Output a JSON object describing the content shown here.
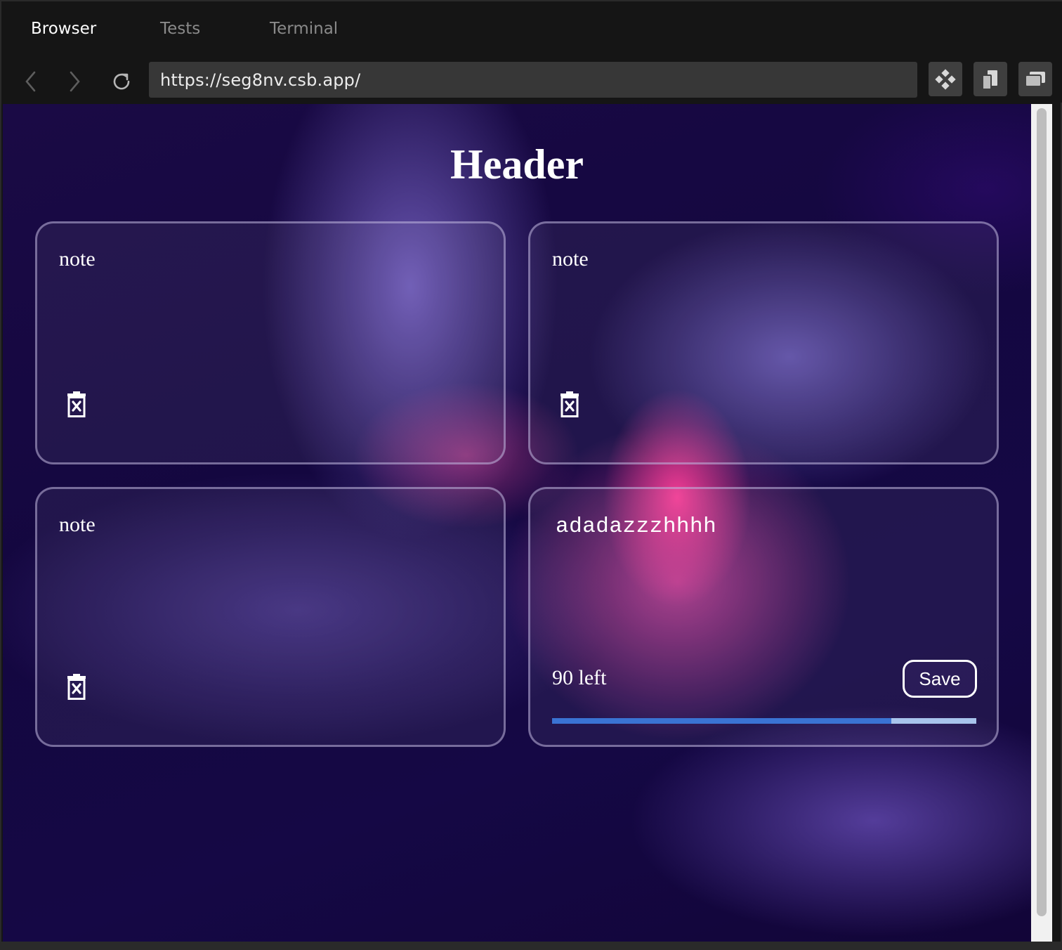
{
  "tabs": [
    {
      "label": "Browser",
      "active": true
    },
    {
      "label": "Tests",
      "active": false
    },
    {
      "label": "Terminal",
      "active": false
    }
  ],
  "toolbar": {
    "url": "https://seg8nv.csb.app/",
    "icons": [
      "chevron-left-icon",
      "chevron-right-icon",
      "reload-icon",
      "devtools-icon",
      "split-view-icon",
      "open-window-icon"
    ]
  },
  "page": {
    "header": "Header",
    "notes": [
      {
        "text": "note"
      },
      {
        "text": "note"
      },
      {
        "text": "note"
      }
    ],
    "editor": {
      "text": "adadazzzhhhh",
      "chars_left": "90 left",
      "save_label": "Save",
      "progress_fraction": 0.8
    }
  },
  "colors": {
    "progress_fill": "#3a73d3",
    "progress_track": "#a8c4ec",
    "accent_pink": "#f83c96"
  }
}
